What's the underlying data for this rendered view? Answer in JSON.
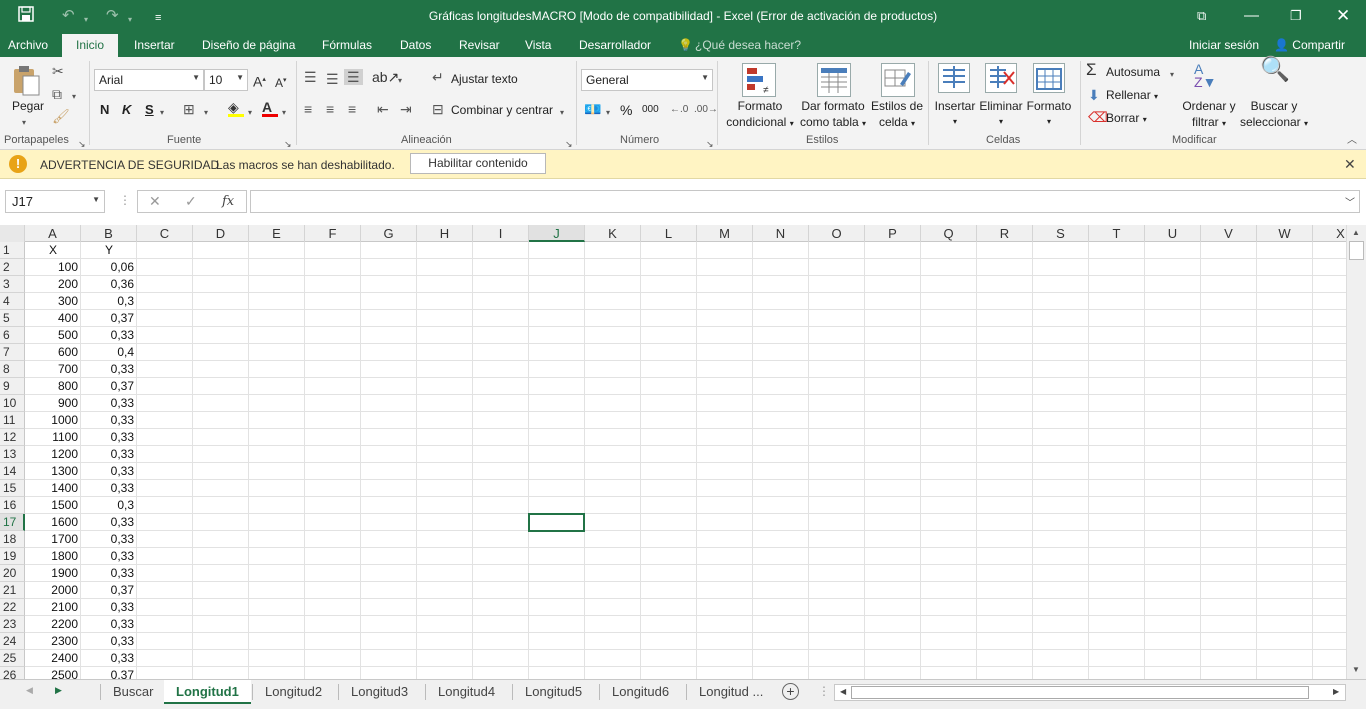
{
  "window": {
    "title": "Gráficas longitudesMACRO  [Modo de compatibilidad] - Excel (Error de activación de productos)",
    "save_icon": "save-icon",
    "undo_icon": "undo-icon",
    "redo_icon": "redo-icon"
  },
  "menu": {
    "tabs": [
      "Archivo",
      "Inicio",
      "Insertar",
      "Diseño de página",
      "Fórmulas",
      "Datos",
      "Revisar",
      "Vista",
      "Desarrollador"
    ],
    "tell_me": "¿Qué desea hacer?",
    "signin": "Iniciar sesión",
    "share": "Compartir"
  },
  "ribbon": {
    "portapapeles": {
      "paste": "Pegar",
      "label": "Portapapeles"
    },
    "fuente": {
      "font": "Arial",
      "size": "10",
      "bold": "N",
      "italic": "K",
      "underline": "S",
      "label": "Fuente"
    },
    "alineacion": {
      "wrap": "Ajustar texto",
      "merge": "Combinar y centrar",
      "label": "Alineación"
    },
    "numero": {
      "format": "General",
      "percent": "%",
      "thousands": "000",
      "label": "Número"
    },
    "estilos": {
      "cond_line1": "Formato",
      "cond_line2": "condicional",
      "table_line1": "Dar formato",
      "table_line2": "como tabla",
      "cell_line1": "Estilos de",
      "cell_line2": "celda",
      "label": "Estilos"
    },
    "celdas": {
      "insert": "Insertar",
      "delete": "Eliminar",
      "format": "Formato",
      "label": "Celdas"
    },
    "modificar": {
      "autosum": "Autosuma",
      "fill": "Rellenar",
      "clear": "Borrar",
      "sort_line1": "Ordenar y",
      "sort_line2": "filtrar",
      "find_line1": "Buscar y",
      "find_line2": "seleccionar",
      "label": "Modificar"
    }
  },
  "security": {
    "title": "ADVERTENCIA DE SEGURIDAD",
    "message": "Las macros se han deshabilitado.",
    "button": "Habilitar contenido"
  },
  "formula": {
    "namebox": "J17",
    "fx": "fx",
    "value": ""
  },
  "columns": [
    "A",
    "B",
    "C",
    "D",
    "E",
    "F",
    "G",
    "H",
    "I",
    "J",
    "K",
    "L",
    "M",
    "N",
    "O",
    "P",
    "Q",
    "R",
    "S",
    "T",
    "U",
    "V",
    "W",
    "X"
  ],
  "row_numbers": [
    "1",
    "2",
    "3",
    "4",
    "5",
    "6",
    "7",
    "8",
    "9",
    "10",
    "11",
    "12",
    "13",
    "14",
    "15",
    "16",
    "17",
    "18",
    "19",
    "20",
    "21",
    "22",
    "23",
    "24",
    "25",
    "26"
  ],
  "rows": [
    [
      "X",
      "Y"
    ],
    [
      "100",
      "0,06"
    ],
    [
      "200",
      "0,36"
    ],
    [
      "300",
      "0,3"
    ],
    [
      "400",
      "0,37"
    ],
    [
      "500",
      "0,33"
    ],
    [
      "600",
      "0,4"
    ],
    [
      "700",
      "0,33"
    ],
    [
      "800",
      "0,37"
    ],
    [
      "900",
      "0,33"
    ],
    [
      "1000",
      "0,33"
    ],
    [
      "1100",
      "0,33"
    ],
    [
      "1200",
      "0,33"
    ],
    [
      "1300",
      "0,33"
    ],
    [
      "1400",
      "0,33"
    ],
    [
      "1500",
      "0,3"
    ],
    [
      "1600",
      "0,33"
    ],
    [
      "1700",
      "0,33"
    ],
    [
      "1800",
      "0,33"
    ],
    [
      "1900",
      "0,33"
    ],
    [
      "2000",
      "0,37"
    ],
    [
      "2100",
      "0,33"
    ],
    [
      "2200",
      "0,33"
    ],
    [
      "2300",
      "0,33"
    ],
    [
      "2400",
      "0,33"
    ],
    [
      "2500",
      "0,37"
    ]
  ],
  "selected": {
    "column": "J",
    "row": "17"
  },
  "sheets": [
    "Buscar",
    "Longitud1",
    "Longitud2",
    "Longitud3",
    "Longitud4",
    "Longitud5",
    "Longitud6",
    "Longitud ..."
  ],
  "active_sheet": "Longitud1",
  "accent": "#217346"
}
